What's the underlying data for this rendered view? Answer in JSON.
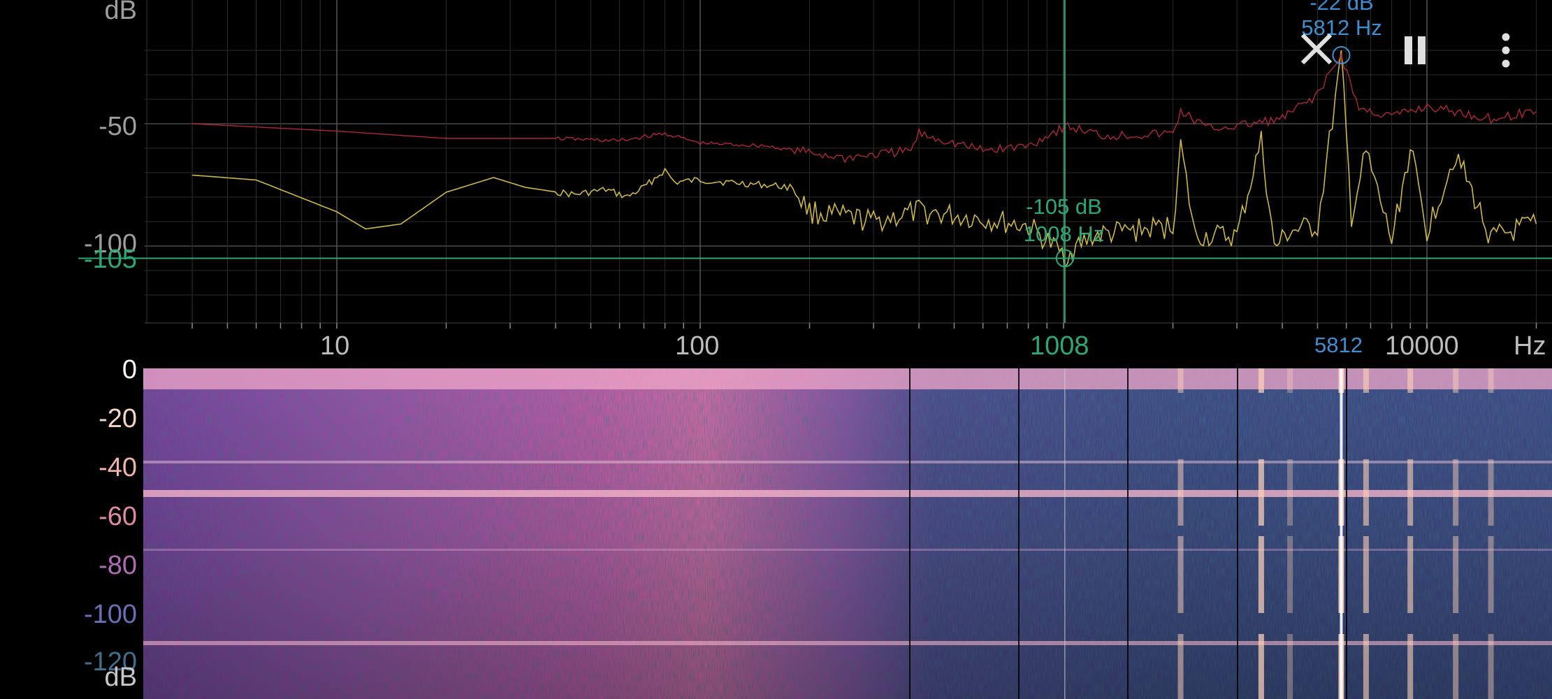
{
  "spectrum": {
    "unit_top": "dB",
    "y_ticks": [
      "-50",
      "-100"
    ],
    "cursor_db_label": "-105",
    "x_ticks": [
      "10",
      "100",
      "10000"
    ],
    "x_unit": "Hz",
    "cursor_freq_tick": "1008",
    "peak_freq_tick": "5812",
    "cursor_readout": {
      "db": "-105 dB",
      "hz": "1008 Hz"
    },
    "peak_readout": {
      "db": "-22 dB",
      "hz": "5812 Hz"
    },
    "colors": {
      "cursor": "#2aa876",
      "peak": "#3d8fd1",
      "live": "#d8c24a",
      "hold": "#b8283a"
    }
  },
  "spectrogram": {
    "y_ticks": [
      "0",
      "-20",
      "-40",
      "-60",
      "-80",
      "-100",
      "-120"
    ],
    "unit": "dB",
    "tick_colors": [
      "#ffffff",
      "#f3d5c8",
      "#f0b4a8",
      "#e08aa6",
      "#b06ab8",
      "#6b6fb8",
      "#3f6f8c"
    ]
  },
  "controls": {
    "close_icon": "close-icon",
    "pause_icon": "pause-icon",
    "menu_icon": "more-vert-icon"
  },
  "chart_data": {
    "type": "line",
    "xlabel": "Hz",
    "ylabel": "dB",
    "x_scale": "log",
    "xlim": [
      4,
      22050
    ],
    "ylim": [
      -128,
      -20
    ],
    "grid": true,
    "series": [
      {
        "color": "#d8c24a",
        "x": [
          4,
          6,
          10,
          12,
          15,
          20,
          27,
          33,
          45,
          55,
          63,
          70,
          80,
          85,
          100,
          120,
          150,
          180,
          200,
          300,
          400,
          600,
          800,
          1008,
          1200,
          1500,
          2000,
          2100,
          2300,
          3000,
          3500,
          3800,
          4200,
          5000,
          5812,
          6200,
          6800,
          8000,
          9000,
          10000,
          12000,
          15000,
          20000
        ],
        "y": [
          -71,
          -73,
          -86,
          -93,
          -91,
          -78,
          -72,
          -76,
          -79,
          -77,
          -80,
          -76,
          -69,
          -74,
          -73,
          -74,
          -75,
          -76,
          -86,
          -90,
          -86,
          -89,
          -92,
          -104,
          -96,
          -94,
          -92,
          -59,
          -96,
          -96,
          -57,
          -101,
          -94,
          -92,
          -23,
          -88,
          -62,
          -98,
          -60,
          -94,
          -62,
          -97,
          -91
        ]
      },
      {
        "color": "#b8283a",
        "x": [
          4,
          10,
          20,
          40,
          60,
          80,
          100,
          150,
          250,
          380,
          400,
          600,
          800,
          1008,
          1300,
          2000,
          2100,
          2500,
          3000,
          4000,
          5000,
          5812,
          6500,
          8000,
          10000,
          15000,
          20000
        ],
        "y": [
          -50,
          -53,
          -56,
          -56,
          -57,
          -54,
          -58,
          -59,
          -64,
          -61,
          -54,
          -61,
          -59,
          -51,
          -55,
          -54,
          -45,
          -52,
          -51,
          -48,
          -38,
          -22,
          -44,
          -47,
          -43,
          -48,
          -45
        ]
      }
    ]
  }
}
